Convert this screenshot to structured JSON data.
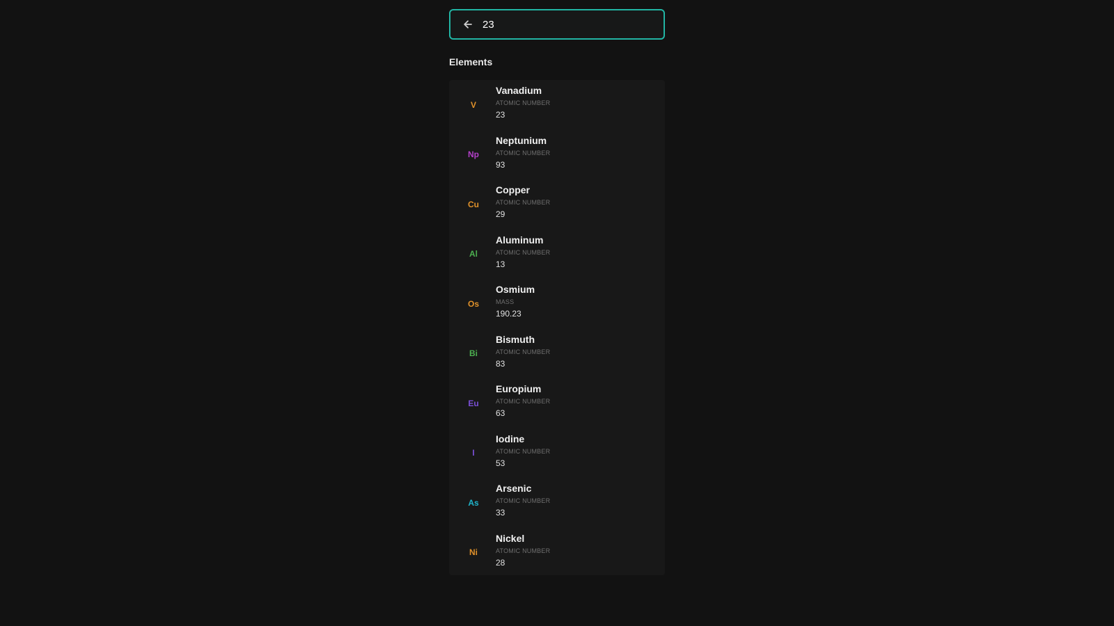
{
  "search": {
    "value": "23"
  },
  "section_title": "Elements",
  "results": [
    {
      "symbol": "V",
      "name": "Vanadium",
      "label": "ATOMIC NUMBER",
      "value": "23",
      "color": "#e0912a"
    },
    {
      "symbol": "Np",
      "name": "Neptunium",
      "label": "ATOMIC NUMBER",
      "value": "93",
      "color": "#b23fc8"
    },
    {
      "symbol": "Cu",
      "name": "Copper",
      "label": "ATOMIC NUMBER",
      "value": "29",
      "color": "#e0912a"
    },
    {
      "symbol": "Al",
      "name": "Aluminum",
      "label": "ATOMIC NUMBER",
      "value": "13",
      "color": "#4caf50"
    },
    {
      "symbol": "Os",
      "name": "Osmium",
      "label": "MASS",
      "value": "190.23",
      "color": "#e0912a"
    },
    {
      "symbol": "Bi",
      "name": "Bismuth",
      "label": "ATOMIC NUMBER",
      "value": "83",
      "color": "#4caf50"
    },
    {
      "symbol": "Eu",
      "name": "Europium",
      "label": "ATOMIC NUMBER",
      "value": "63",
      "color": "#7a4fd6"
    },
    {
      "symbol": "I",
      "name": "Iodine",
      "label": "ATOMIC NUMBER",
      "value": "53",
      "color": "#7a4fd6"
    },
    {
      "symbol": "As",
      "name": "Arsenic",
      "label": "ATOMIC NUMBER",
      "value": "33",
      "color": "#1fb3c9"
    },
    {
      "symbol": "Ni",
      "name": "Nickel",
      "label": "ATOMIC NUMBER",
      "value": "28",
      "color": "#e0912a"
    }
  ],
  "colors": {
    "accent": "#22b5a4",
    "background": "#121212",
    "panel": "#181818"
  },
  "icons": {
    "back": "arrow-left-icon"
  }
}
